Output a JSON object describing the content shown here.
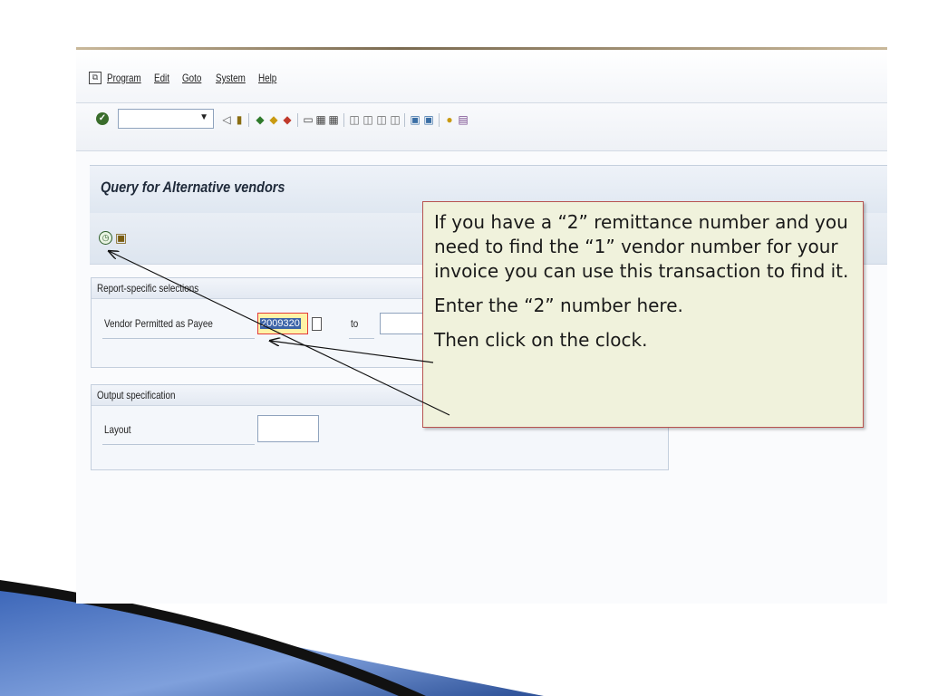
{
  "menu": {
    "items": [
      "Program",
      "Edit",
      "Goto",
      "System",
      "Help"
    ]
  },
  "page": {
    "title": "Query for Alternative vendors"
  },
  "report_selections": {
    "header": "Report-specific selections",
    "vendor_label": "Vendor Permitted as Payee",
    "vendor_value": "2009320",
    "to_label": "to"
  },
  "output_spec": {
    "header": "Output specification",
    "layout_label": "Layout"
  },
  "callout": {
    "para1": "If you have a “2” remittance number and you need to find the “1” vendor number for your invoice you can use this transaction to find it.",
    "para2": "Enter the “2” number here.",
    "para3": "Then click on the clock."
  },
  "colors": {
    "callout_bg": "#f0f2dc",
    "callout_border": "#b85450",
    "active_field": "#fff3a6",
    "selection": "#3c63a8"
  }
}
